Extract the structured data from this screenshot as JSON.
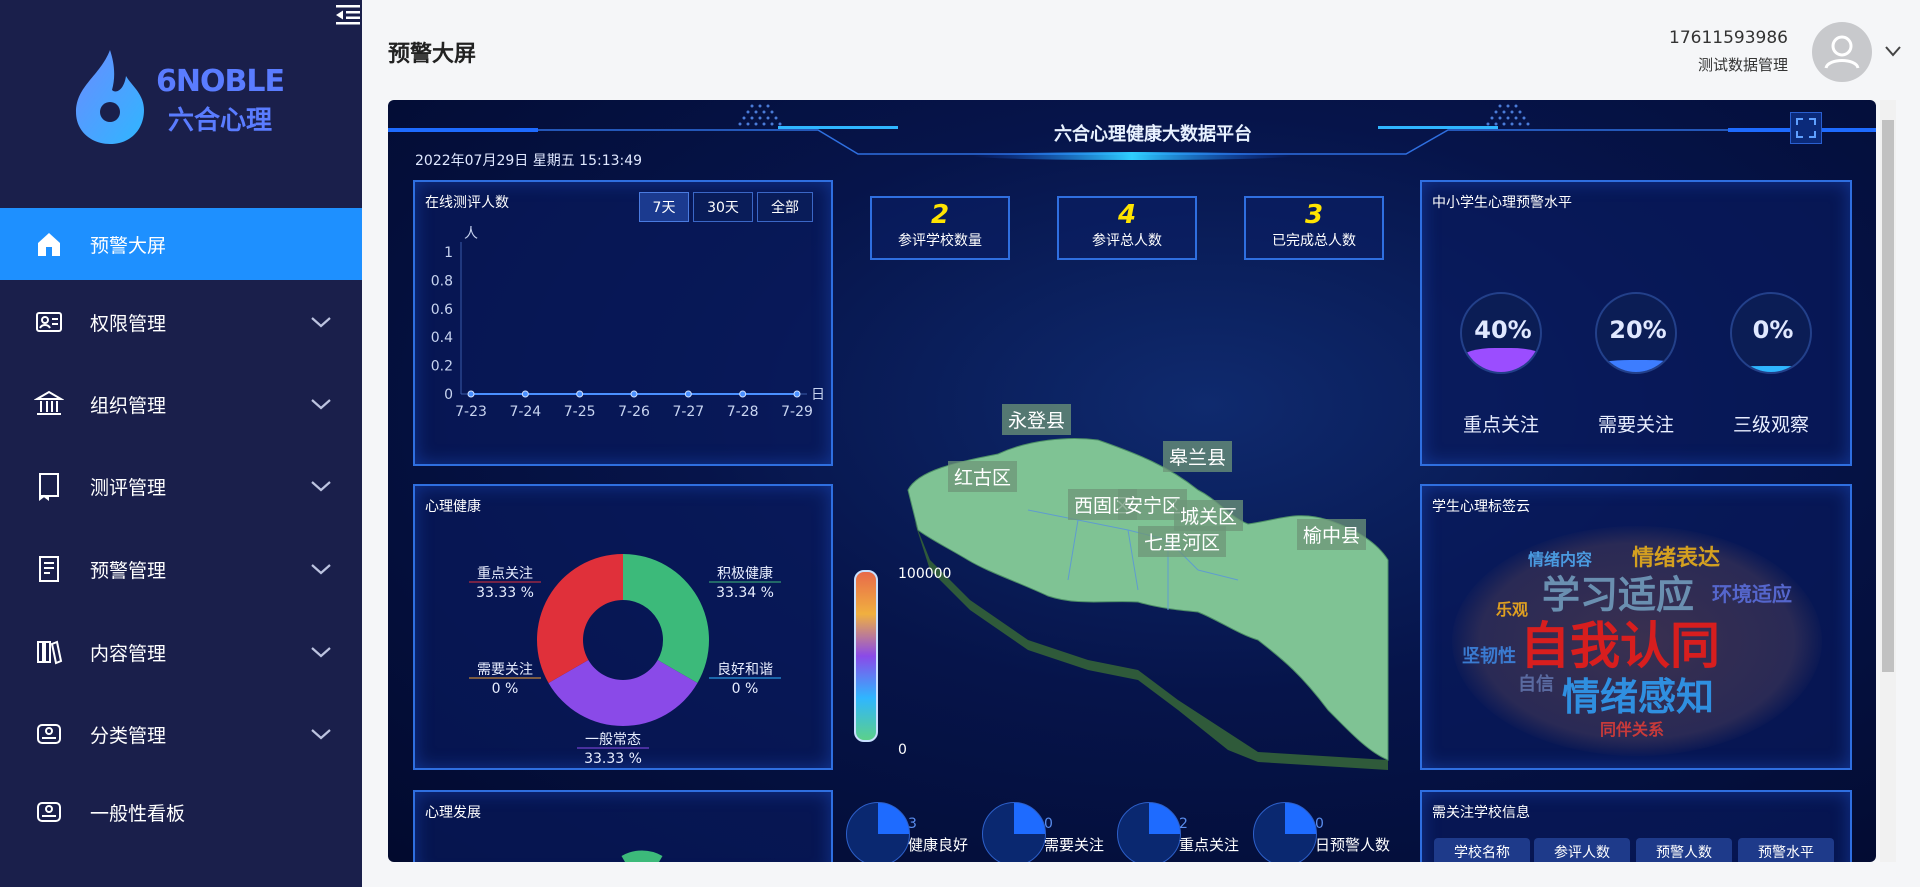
{
  "sidebar": {
    "logo": {
      "en": "6NOBLE",
      "zh": "六合心理"
    },
    "items": [
      {
        "label": "预警大屏",
        "icon": "home-icon",
        "active": true,
        "chevron": false
      },
      {
        "label": "权限管理",
        "icon": "user-card-icon",
        "active": false,
        "chevron": true
      },
      {
        "label": "组织管理",
        "icon": "bank-icon",
        "active": false,
        "chevron": true
      },
      {
        "label": "测评管理",
        "icon": "book-icon",
        "active": false,
        "chevron": true
      },
      {
        "label": "预警管理",
        "icon": "document-icon",
        "active": false,
        "chevron": true
      },
      {
        "label": "内容管理",
        "icon": "library-icon",
        "active": false,
        "chevron": true
      },
      {
        "label": "分类管理",
        "icon": "folder-user-icon",
        "active": false,
        "chevron": true
      },
      {
        "label": "一般性看板",
        "icon": "board-icon",
        "active": false,
        "chevron": false
      }
    ]
  },
  "header": {
    "page_title": "预警大屏",
    "user_phone": "17611593986",
    "user_org": "测试数据管理"
  },
  "screen": {
    "title": "六合心理健康大数据平台",
    "datetime": "2022年07月29日 星期五 15:13:49",
    "online_panel": {
      "title": "在线测评人数",
      "ranges": [
        "7天",
        "30天",
        "全部"
      ],
      "selected_range": "7天",
      "y_unit": "人",
      "x_end_label": "日"
    },
    "stats": [
      {
        "value": "2",
        "label": "参评学校数量"
      },
      {
        "value": "4",
        "label": "参评总人数"
      },
      {
        "value": "3",
        "label": "已完成总人数"
      }
    ],
    "warning_panel": {
      "title": "中小学生心理预警水平",
      "levels": [
        {
          "pct": "40%",
          "value": 0.4,
          "label": "重点关注",
          "color": "#9b4dff"
        },
        {
          "pct": "20%",
          "value": 0.2,
          "label": "需要关注",
          "color": "#3d7dff"
        },
        {
          "pct": "0%",
          "value": 0.0,
          "label": "三级观察",
          "color": "#2fb6ff"
        }
      ]
    },
    "health_panel": {
      "title": "心理健康",
      "slices": [
        {
          "name": "积极健康",
          "pct": "33.34 %",
          "value": 33.34,
          "color": "#3cba7a"
        },
        {
          "name": "良好和谐",
          "pct": "0 %",
          "value": 0,
          "color": "#2fb6ff"
        },
        {
          "name": "一般常态",
          "pct": "33.33 %",
          "value": 33.33,
          "color": "#8a4ae8"
        },
        {
          "name": "需要关注",
          "pct": "0 %",
          "value": 0,
          "color": "#f0a030"
        },
        {
          "name": "重点关注",
          "pct": "33.33 %",
          "value": 33.33,
          "color": "#e0303a"
        }
      ]
    },
    "legend": {
      "max": "100000",
      "min": "0"
    },
    "map_labels": [
      "永登县",
      "皋兰县",
      "红古区",
      "西固区",
      "安宁区",
      "城关区",
      "七里河区",
      "榆中县"
    ],
    "tagcloud": {
      "title": "学生心理标签云",
      "words": [
        {
          "text": "自我认同",
          "color": "#d81e1e"
        },
        {
          "text": "情绪感知",
          "color": "#2f8fe0"
        },
        {
          "text": "学习适应",
          "color": "#6a8fb0"
        },
        {
          "text": "情绪表达",
          "color": "#d4a020"
        },
        {
          "text": "环境适应",
          "color": "#5566cc"
        },
        {
          "text": "情绪内容",
          "color": "#4a9ae0"
        },
        {
          "text": "乐观",
          "color": "#e0a020"
        },
        {
          "text": "坚韧性",
          "color": "#3a7ad0"
        },
        {
          "text": "自信",
          "color": "#5a6aa0"
        },
        {
          "text": "同伴关系",
          "color": "#c83a3a"
        }
      ]
    },
    "development_panel": {
      "title": "心理发展"
    },
    "radar_items": [
      {
        "value": "3",
        "label": "健康良好"
      },
      {
        "value": "0",
        "label": "需要关注"
      },
      {
        "value": "2",
        "label": "重点关注"
      },
      {
        "value": "0",
        "label": "日预警人数"
      }
    ],
    "school_panel": {
      "title": "需关注学校信息",
      "columns": [
        "学校名称",
        "参评人数",
        "预警人数",
        "预警水平"
      ]
    }
  },
  "chart_data": {
    "type": "line",
    "x": [
      "7-23",
      "7-24",
      "7-25",
      "7-26",
      "7-27",
      "7-28",
      "7-29"
    ],
    "values": [
      0,
      0,
      0,
      0,
      0,
      0,
      0
    ],
    "yticks": [
      "0",
      "0.2",
      "0.4",
      "0.6",
      "0.8",
      "1"
    ],
    "ylim": [
      0,
      1
    ],
    "ylabel": "人",
    "xlabel": "日",
    "color": "#4a90ff"
  }
}
